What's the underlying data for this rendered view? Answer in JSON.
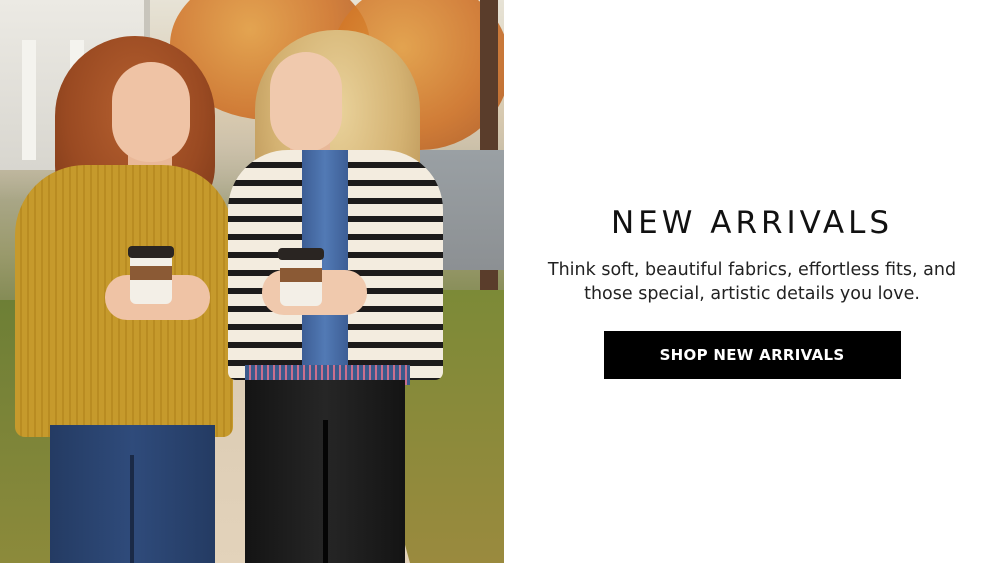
{
  "hero": {
    "image": "two-women-walking-autumn-street-photo",
    "colors": {
      "mustard_top": "#c69a2c",
      "stripes_light": "#f3ecdf",
      "stripes_dark": "#1d1b1b",
      "denim": "#527ab5"
    }
  },
  "promo": {
    "headline": "NEW ARRIVALS",
    "description": "Think soft, beautiful fabrics, effortless fits, and those special, artistic details you love.",
    "cta_label": "SHOP NEW ARRIVALS",
    "colors": {
      "background": "#ffffff",
      "text": "#111111",
      "button_bg": "#000000",
      "button_text": "#ffffff"
    }
  }
}
